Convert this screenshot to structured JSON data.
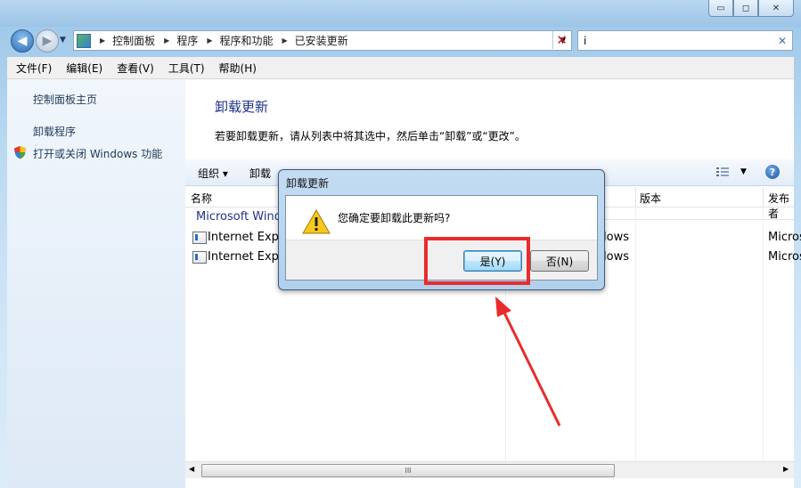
{
  "window": {
    "controls": {
      "minimize": "▭",
      "maximize": "◻",
      "close": "✕"
    }
  },
  "navigation": {
    "breadcrumbs": [
      "控制面板",
      "程序",
      "程序和功能",
      "已安装更新"
    ],
    "search_value": "i"
  },
  "menubar": {
    "items": [
      "文件(F)",
      "编辑(E)",
      "查看(V)",
      "工具(T)",
      "帮助(H)"
    ]
  },
  "sidebar": {
    "links": [
      "控制面板主页",
      "卸载程序",
      "打开或关闭 Windows 功能"
    ]
  },
  "main": {
    "title": "卸载更新",
    "instruction": "若要卸载更新，请从列表中将其选中，然后单击“卸载”或“更改”。",
    "toolbar": {
      "organize": "组织 ▾",
      "uninstall": "卸载"
    },
    "columns": [
      "名称",
      "版本",
      "发布者"
    ],
    "group_header": "Microsoft Windows",
    "rows": [
      {
        "name": "Internet Explorer",
        "program": "Windows",
        "publisher": "Microsoft"
      },
      {
        "name": "Internet Explorer",
        "program": "Windows",
        "publisher": "Microsoft"
      }
    ],
    "scroll_grip": "III"
  },
  "dialog": {
    "title": "卸载更新",
    "message": "您确定要卸载此更新吗?",
    "yes_button": "是(Y)",
    "no_button": "否(N)"
  },
  "colors": {
    "annotation": "#ea2b2b",
    "heading": "#1e3287",
    "link": "#1e3a5a"
  }
}
